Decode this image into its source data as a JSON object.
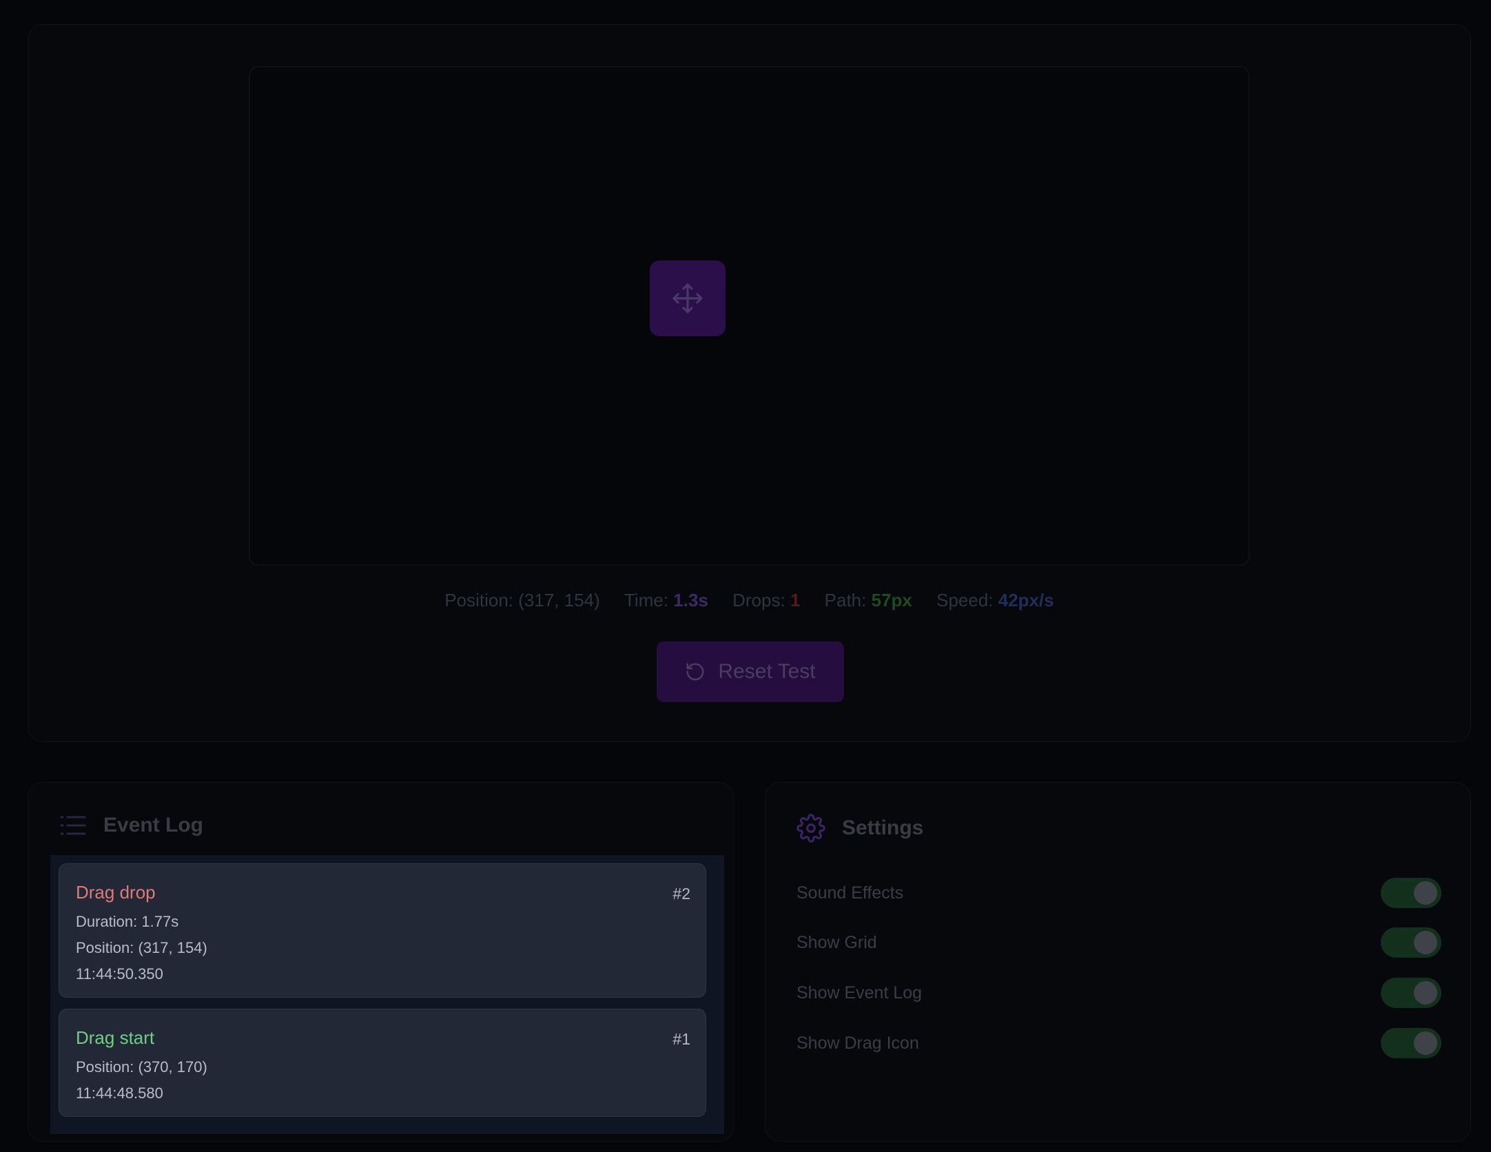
{
  "stats": {
    "position_label": "Position:",
    "position_value": "(317, 154)",
    "time_label": "Time:",
    "time_value": "1.3s",
    "drops_label": "Drops:",
    "drops_value": "1",
    "path_label": "Path:",
    "path_value": "57px",
    "speed_label": "Speed:",
    "speed_value": "42px/s"
  },
  "reset_button": {
    "label": "Reset Test",
    "icon": "rotate-ccw-icon"
  },
  "drag_item": {
    "icon": "move-arrows-icon"
  },
  "event_log": {
    "title": "Event Log",
    "icon": "list-icon",
    "events": [
      {
        "title": "Drag drop",
        "number": "#2",
        "lines": [
          "Duration: 1.77s",
          "Position: (317, 154)",
          "11:44:50.350"
        ],
        "color": "#e27878"
      },
      {
        "title": "Drag start",
        "number": "#1",
        "lines": [
          "Position: (370, 170)",
          "11:44:48.580"
        ],
        "color": "#6fcf83"
      }
    ]
  },
  "settings": {
    "title": "Settings",
    "icon": "gear-icon",
    "items": [
      {
        "label": "Sound Effects",
        "enabled": true
      },
      {
        "label": "Show Grid",
        "enabled": true
      },
      {
        "label": "Show Event Log",
        "enabled": true
      },
      {
        "label": "Show Drag Icon",
        "enabled": true
      }
    ]
  }
}
